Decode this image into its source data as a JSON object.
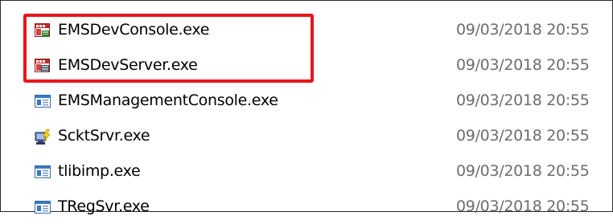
{
  "highlight_color": "#e8141c",
  "files": [
    {
      "name": "EMSDevConsole.exe",
      "date": "09/03/2018 20:55",
      "icon": "ems-dev-console-icon"
    },
    {
      "name": "EMSDevServer.exe",
      "date": "09/03/2018 20:55",
      "icon": "ems-dev-server-icon"
    },
    {
      "name": "EMSManagementConsole.exe",
      "date": "09/03/2018 20:55",
      "icon": "application-window-icon"
    },
    {
      "name": "ScktSrvr.exe",
      "date": "09/03/2018 20:55",
      "icon": "socket-server-icon"
    },
    {
      "name": "tlibimp.exe",
      "date": "09/03/2018 20:55",
      "icon": "application-window-icon"
    },
    {
      "name": "TRegSvr.exe",
      "date": "09/03/2018 20:55",
      "icon": "application-window-icon"
    }
  ]
}
